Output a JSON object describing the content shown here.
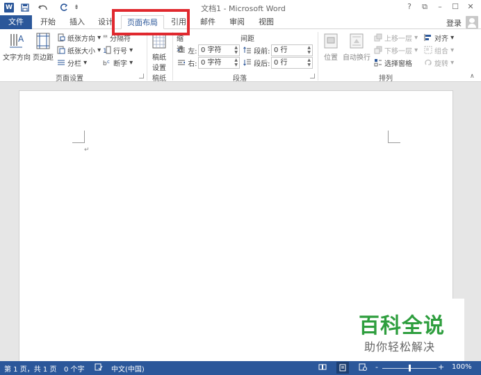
{
  "titlebar": {
    "app_icon": "W",
    "title": "文档1 - Microsoft Word",
    "quick_access": [
      "save-icon",
      "undo-icon",
      "redo-icon",
      "customize-icon"
    ],
    "controls": [
      "?",
      "⧉",
      "–",
      "☐",
      "✕"
    ]
  },
  "tabs": {
    "file": "文件",
    "items": [
      "开始",
      "插入",
      "设计",
      "页面布局",
      "引用",
      "邮件",
      "审阅",
      "视图"
    ],
    "active": "页面布局",
    "login": "登录"
  },
  "ribbon": {
    "page_setup": {
      "label": "页面设置",
      "text_direction": "文字方向",
      "margins": "页边距",
      "orientation": "纸张方向",
      "size": "纸张大小",
      "columns": "分栏",
      "breaks": "分隔符",
      "line_numbers": "行号",
      "hyphenation": "断字"
    },
    "draft": {
      "label": "稿纸",
      "button_line1": "稿纸",
      "button_line2": "设置"
    },
    "paragraph": {
      "label": "段落",
      "indent_title": "缩进",
      "spacing_title": "间距",
      "left_label": "左:",
      "right_label": "右:",
      "left_value": "0 字符",
      "right_value": "0 字符",
      "before_label": "段前:",
      "after_label": "段后:",
      "before_value": "0 行",
      "after_value": "0 行"
    },
    "arrange": {
      "label": "排列",
      "position": "位置",
      "wrap_text": "自动换行",
      "bring_forward": "上移一层",
      "send_backward": "下移一层",
      "selection_pane": "选择窗格",
      "align": "对齐",
      "group": "组合",
      "rotate": "旋转"
    }
  },
  "document": {
    "paragraph_mark": "↵"
  },
  "watermark": {
    "title": "百科全说",
    "subtitle": "助你轻松解决"
  },
  "statusbar": {
    "page": "第 1 页，共 1 页",
    "words": "0 个字",
    "language": "中文(中国)",
    "zoom_minus": "-",
    "zoom_plus": "+",
    "zoom": "100%"
  },
  "colors": {
    "accent": "#2b579a",
    "highlight_box": "#e0282e",
    "watermark_green": "#2e9e3e"
  }
}
